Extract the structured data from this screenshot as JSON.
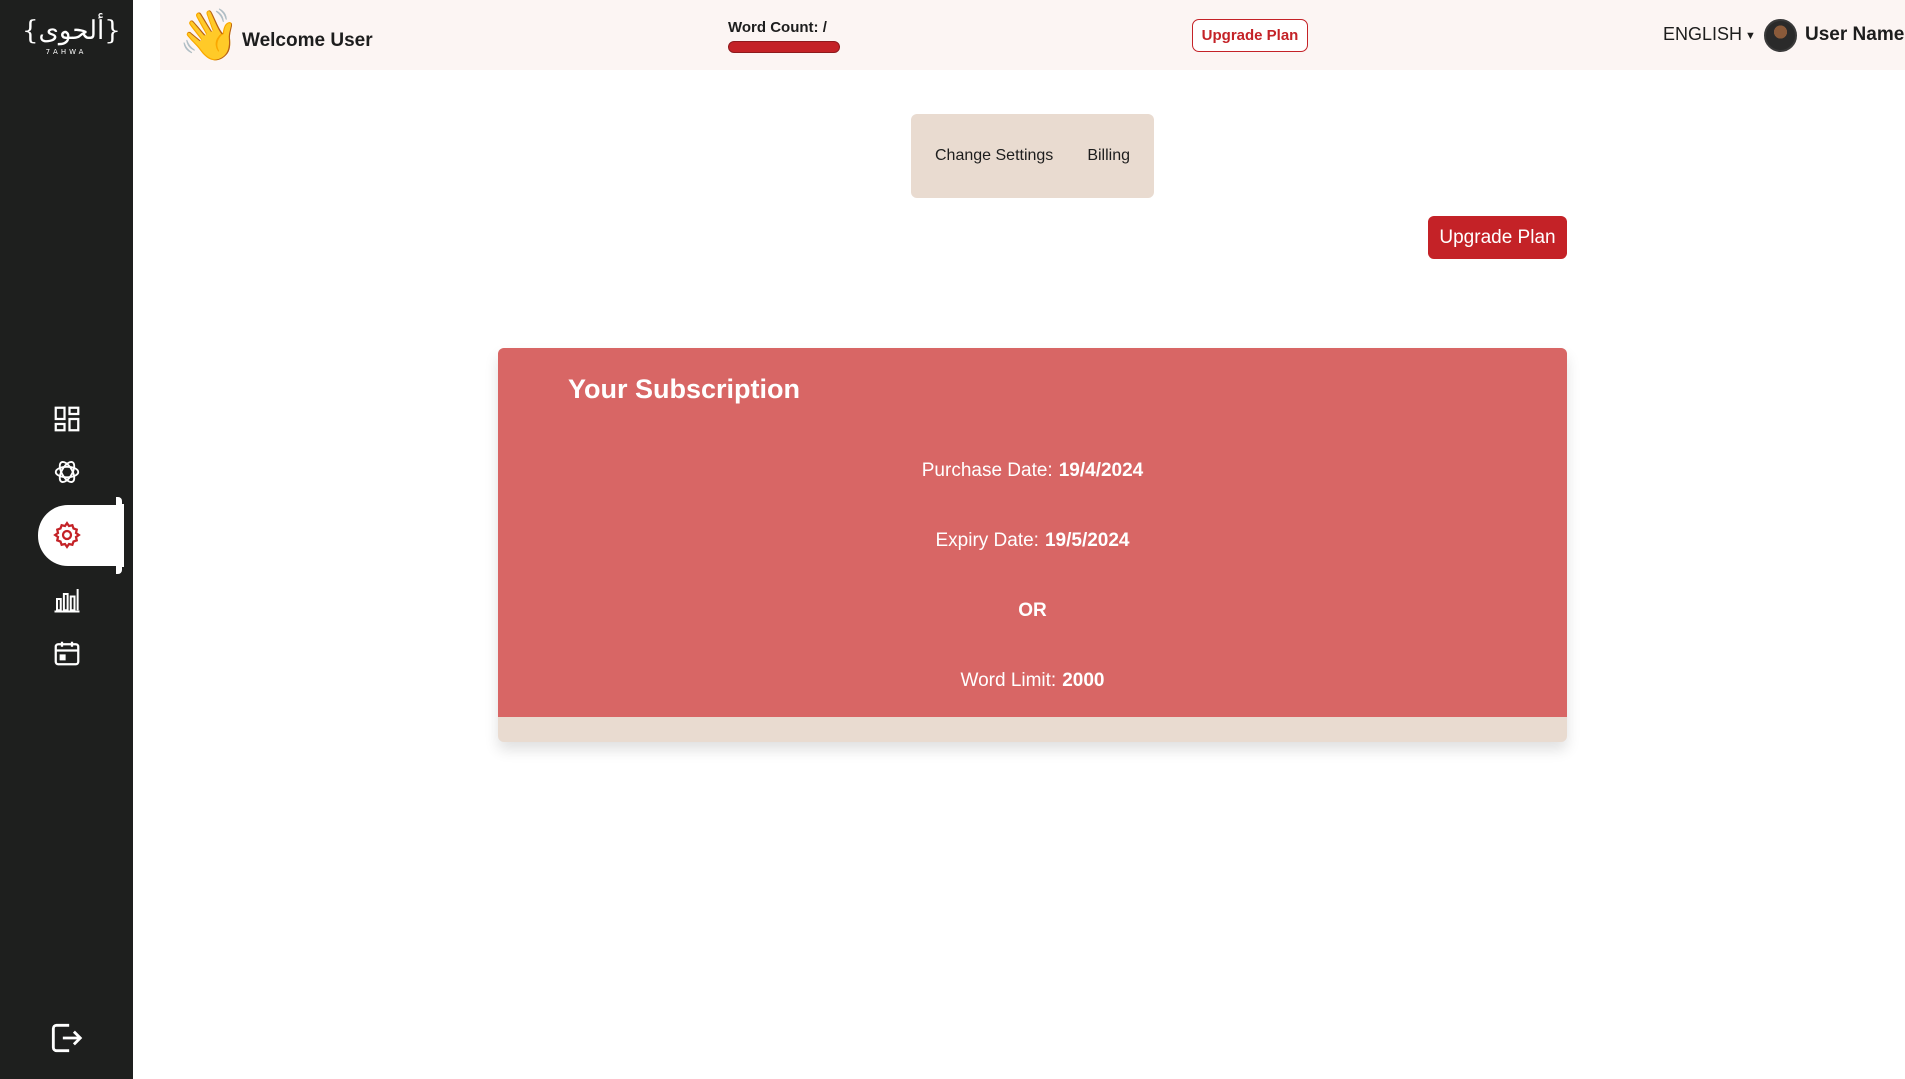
{
  "sidebar": {
    "logo": {
      "main": "{ألحوى}",
      "sub": "7AHWA"
    },
    "items": [
      {
        "name": "dashboard-icon"
      },
      {
        "name": "ai-chat-icon"
      },
      {
        "name": "settings-icon",
        "active": true
      },
      {
        "name": "analytics-icon"
      },
      {
        "name": "calendar-icon"
      }
    ],
    "logout": "logout-icon"
  },
  "header": {
    "welcome": "Welcome User",
    "word_count_label": "Word Count:  /",
    "upgrade_label": "Upgrade Plan",
    "language": "ENGLISH",
    "user_name": "User Name"
  },
  "tabs": [
    {
      "label": "Change Settings"
    },
    {
      "label": "Billing"
    }
  ],
  "main": {
    "upgrade_button": "Upgrade Plan",
    "subscription": {
      "title": "Your Subscription",
      "purchase_label": "Purchase Date:",
      "purchase_value": "19/4/2024",
      "expiry_label": "Expiry Date:",
      "expiry_value": "19/5/2024",
      "or_text": "OR",
      "limit_label": "Word Limit:",
      "limit_value": "2000"
    }
  },
  "colors": {
    "accent": "#c42227",
    "sidebar": "#1e1f1e",
    "card": "#d86665",
    "beige": "#e9dbd0"
  }
}
